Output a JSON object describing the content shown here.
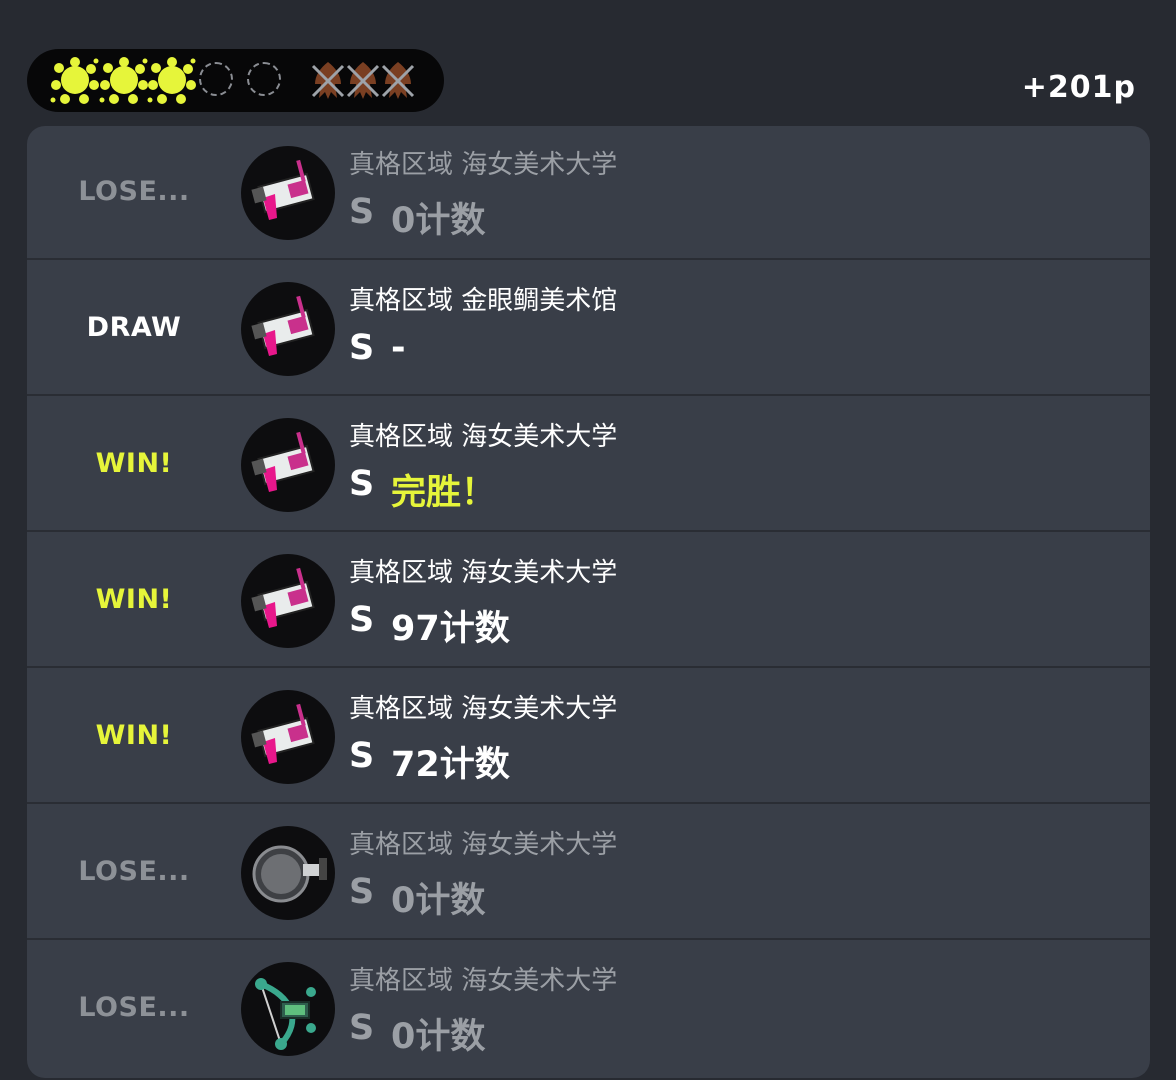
{
  "summary": {
    "win_marks": 3,
    "empty_win_slots": 2,
    "loss_marks": 3,
    "points": "+201p"
  },
  "colors": {
    "win": "#e6f53a",
    "lose": "#8d9197",
    "draw": "#ffffff",
    "loss_squid": "#7a3f22",
    "panel": "#393e48",
    "background": "#272a31"
  },
  "matches": [
    {
      "result": "LOSE...",
      "stage": "真格区域 海女美术大学",
      "rank": "S",
      "score": "0计数",
      "weapon_icon": "splat-charger-icon"
    },
    {
      "result": "DRAW",
      "stage": "真格区域 金眼鲷美术馆",
      "rank": "S",
      "score": "-",
      "weapon_icon": "splat-charger-icon"
    },
    {
      "result": "WIN!",
      "stage": "真格区域 海女美术大学",
      "rank": "S",
      "score": "完胜！",
      "weapon_icon": "splat-charger-icon"
    },
    {
      "result": "WIN!",
      "stage": "真格区域 海女美术大学",
      "rank": "S",
      "score": "97计数",
      "weapon_icon": "splat-charger-icon"
    },
    {
      "result": "WIN!",
      "stage": "真格区域 海女美术大学",
      "rank": "S",
      "score": "72计数",
      "weapon_icon": "splat-charger-icon"
    },
    {
      "result": "LOSE...",
      "stage": "真格区域 海女美术大学",
      "rank": "S",
      "score": "0计数",
      "weapon_icon": "frying-pan-weapon-icon"
    },
    {
      "result": "LOSE...",
      "stage": "真格区域 海女美术大学",
      "rank": "S",
      "score": "0计数",
      "weapon_icon": "bow-weapon-icon"
    }
  ]
}
